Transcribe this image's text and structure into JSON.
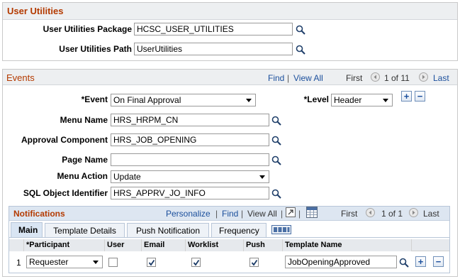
{
  "user_utilities": {
    "title": "User Utilities",
    "package_label": "User Utilities Package",
    "package_value": "HCSC_USER_UTILITIES",
    "path_label": "User Utilities Path",
    "path_value": "UserUtilities"
  },
  "events": {
    "title": "Events",
    "find_label": "Find",
    "view_all_label": "View All",
    "first_label": "First",
    "pagination": "1 of 11",
    "last_label": "Last",
    "event_label": "*Event",
    "event_value": "On Final Approval",
    "level_label": "*Level",
    "level_value": "Header",
    "menu_name_label": "Menu Name",
    "menu_name_value": "HRS_HRPM_CN",
    "approval_component_label": "Approval Component",
    "approval_component_value": "HRS_JOB_OPENING",
    "page_name_label": "Page Name",
    "page_name_value": "",
    "menu_action_label": "Menu Action",
    "menu_action_value": "Update",
    "sql_object_label": "SQL Object Identifier",
    "sql_object_value": "HRS_APPRV_JO_INFO"
  },
  "notifications": {
    "title": "Notifications",
    "personalize_label": "Personalize",
    "find_label": "Find",
    "view_all_label": "View All",
    "first_label": "First",
    "pagination": "1 of 1",
    "last_label": "Last",
    "tabs": [
      "Main",
      "Template Details",
      "Push Notification",
      "Frequency"
    ],
    "columns": [
      "*Participant",
      "User",
      "Email",
      "Worklist",
      "Push",
      "Template Name"
    ],
    "rows": [
      {
        "num": "1",
        "participant": "Requester",
        "user": false,
        "email": true,
        "worklist": true,
        "push": true,
        "template_name": "JobOpeningApproved"
      }
    ]
  },
  "icons": {
    "lookup": "magnifier-icon",
    "add": "plus-icon",
    "delete": "minus-icon",
    "prev": "arrow-left-icon",
    "next": "arrow-right-icon",
    "zoom": "zoom-icon",
    "download": "grid-download-icon",
    "show_all_tabs": "show-all-tabs-icon"
  },
  "colors": {
    "header_text": "#b43a00",
    "link": "#1b4f9c",
    "header_bg": "#edeff1"
  }
}
